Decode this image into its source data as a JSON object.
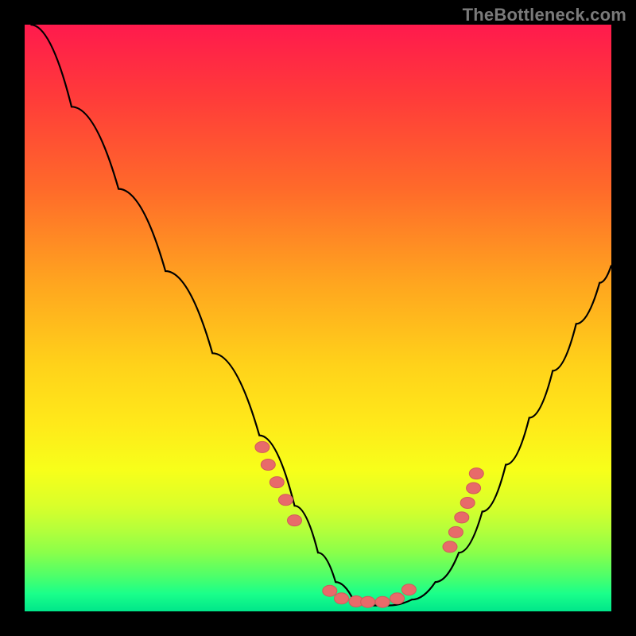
{
  "watermark": "TheBottleneck.com",
  "colors": {
    "marker_fill": "#e86a6a",
    "marker_stroke": "#d15a5a",
    "curve_stroke": "#000000"
  },
  "chart_data": {
    "type": "line",
    "title": "",
    "xlabel": "",
    "ylabel": "",
    "xlim": [
      0,
      100
    ],
    "ylim": [
      0,
      100
    ],
    "series": [
      {
        "name": "curve",
        "x": [
          1,
          8,
          16,
          24,
          32,
          40,
          46,
          50,
          53,
          56,
          59,
          62,
          66,
          70,
          74,
          78,
          82,
          86,
          90,
          94,
          98,
          100
        ],
        "y": [
          100,
          86,
          72,
          58,
          44,
          30,
          18,
          10,
          5,
          2,
          1,
          1,
          2,
          5,
          10,
          17,
          25,
          33,
          41,
          49,
          56,
          59
        ]
      }
    ],
    "markers": [
      {
        "x": 40.5,
        "y": 28
      },
      {
        "x": 41.5,
        "y": 25
      },
      {
        "x": 43.0,
        "y": 22
      },
      {
        "x": 44.5,
        "y": 19
      },
      {
        "x": 46.0,
        "y": 15.5
      },
      {
        "x": 52.0,
        "y": 3.5
      },
      {
        "x": 54.0,
        "y": 2.2
      },
      {
        "x": 56.5,
        "y": 1.7
      },
      {
        "x": 58.5,
        "y": 1.6
      },
      {
        "x": 61.0,
        "y": 1.6
      },
      {
        "x": 63.5,
        "y": 2.2
      },
      {
        "x": 65.5,
        "y": 3.7
      },
      {
        "x": 72.5,
        "y": 11
      },
      {
        "x": 73.5,
        "y": 13.5
      },
      {
        "x": 74.5,
        "y": 16
      },
      {
        "x": 75.5,
        "y": 18.5
      },
      {
        "x": 76.5,
        "y": 21
      },
      {
        "x": 77.0,
        "y": 23.5
      }
    ]
  }
}
